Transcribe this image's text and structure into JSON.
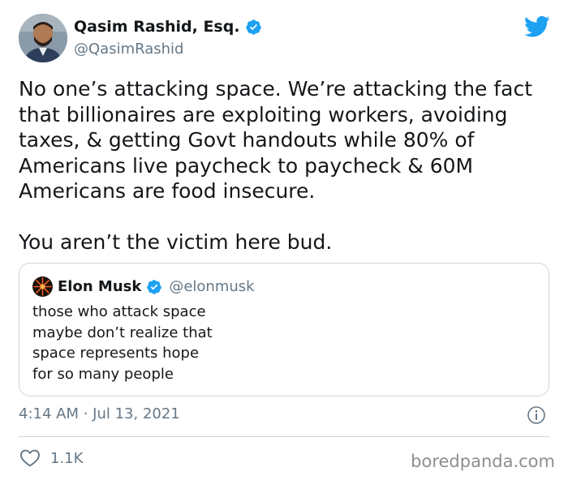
{
  "author": {
    "name": "Qasim Rashid, Esq.",
    "handle": "@QasimRashid",
    "verified": true,
    "avatar_icon": "person-avatar"
  },
  "brand": {
    "icon": "twitter-bird-icon",
    "color": "#1da1f2"
  },
  "tweet": {
    "paragraph_1": "No one’s attacking space. We’re attacking the fact that billionaires are exploiting workers, avoiding taxes, & getting Govt handouts while 80% of Americans live paycheck to paycheck & 60M Americans are food insecure.",
    "paragraph_2": "You aren’t the victim here bud."
  },
  "quoted_tweet": {
    "name": "Elon Musk",
    "handle": "@elonmusk",
    "verified": true,
    "lines": [
      "those who attack space",
      "maybe don’t realize that",
      "space represents hope",
      "for so many people"
    ]
  },
  "timestamp": "4:14 AM · Jul 13, 2021",
  "likes": "1.1K",
  "watermark": "boredpanda.com",
  "colors": {
    "text": "#14171a",
    "secondary": "#657786",
    "border": "#ccd6dd",
    "verified": "#1da1f2"
  }
}
